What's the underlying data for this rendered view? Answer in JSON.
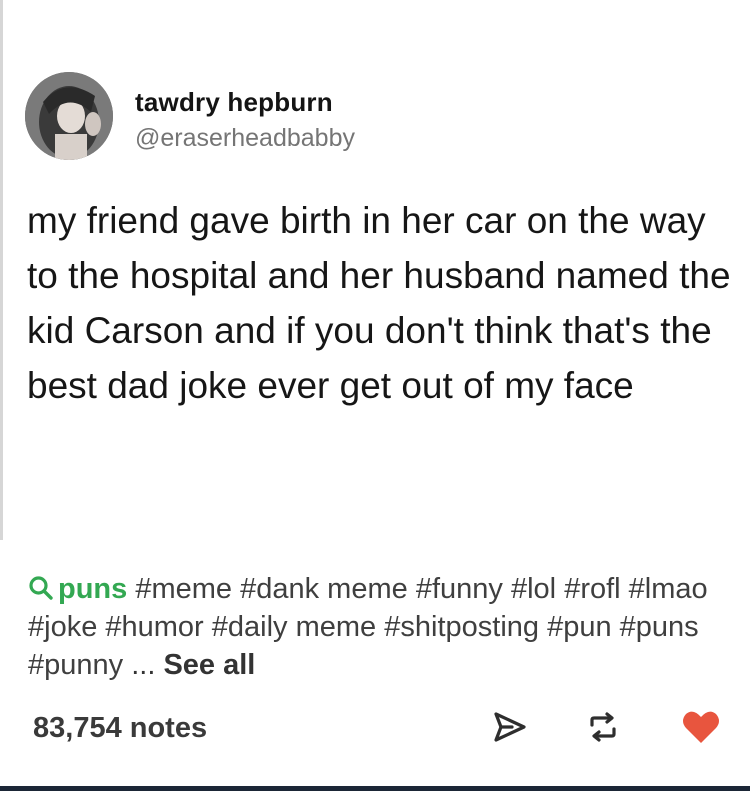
{
  "post": {
    "author": {
      "display_name": "tawdry hepburn",
      "handle": "@eraserheadbabby"
    },
    "text": "my friend gave birth in her car on the way to the hospital and her husband named the kid Carson and if you don't think that's the best dad joke ever get out of my face"
  },
  "tags": {
    "search_tag": "puns",
    "items": [
      "#meme",
      "#dank meme",
      "#funny",
      "#lol",
      "#rofl",
      "#lmao",
      "#joke",
      "#humor",
      "#daily meme",
      "#shitposting",
      "#pun",
      "#puns",
      "#punny"
    ],
    "ellipsis": "...",
    "see_all": "See all"
  },
  "footer": {
    "notes": "83,754 notes",
    "icons": [
      "share-icon",
      "reblog-icon",
      "like-heart-icon"
    ]
  },
  "colors": {
    "search_tag": "#33a852",
    "heart": "#e8553e",
    "bottom_bar": "#1b2636"
  }
}
